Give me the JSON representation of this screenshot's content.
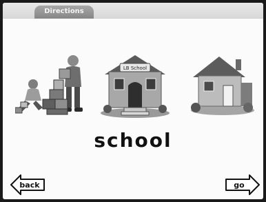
{
  "header": {
    "directions_label": "Directions"
  },
  "pictures": [
    {
      "icon": "children-blocks-icon"
    },
    {
      "icon": "school-building-icon",
      "sign": "LB School"
    },
    {
      "icon": "house-icon"
    }
  ],
  "word": "school",
  "nav": {
    "back_label": "back",
    "go_label": "go"
  }
}
